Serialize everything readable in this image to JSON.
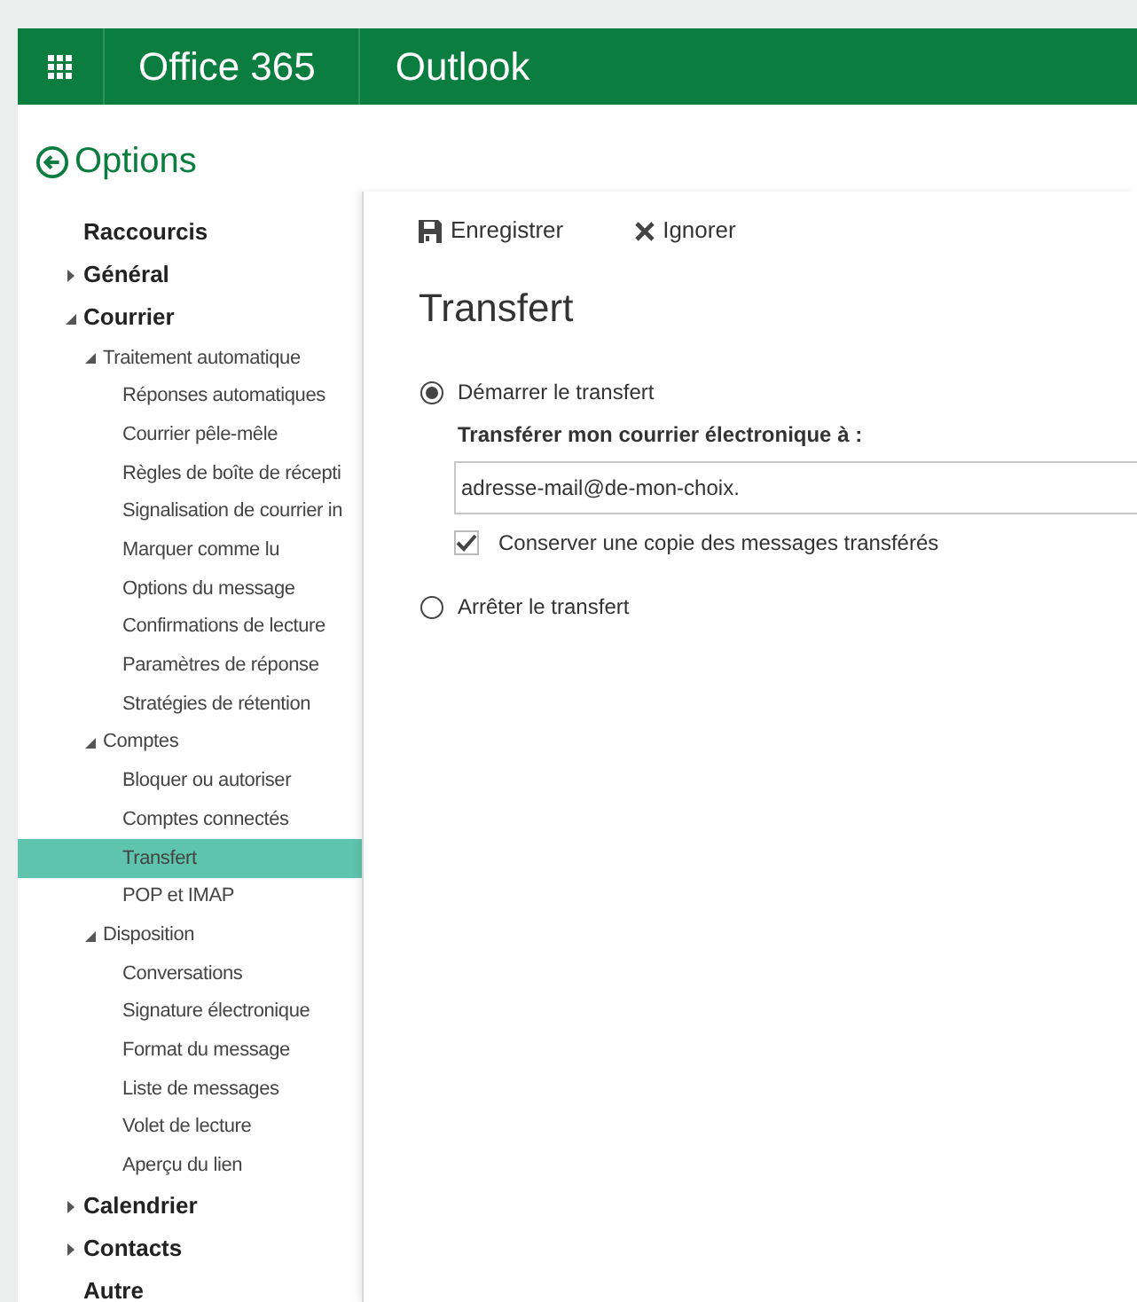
{
  "header": {
    "suite": "Office 365",
    "app": "Outlook"
  },
  "back_title": "Options",
  "sidebar": {
    "items": [
      {
        "label": "Raccourcis",
        "selected": false
      },
      {
        "label": "Général",
        "selected": false,
        "expanded": false
      },
      {
        "label": "Courrier",
        "selected": false,
        "expanded": true,
        "children": [
          {
            "label": "Traitement automatique",
            "selected": false,
            "expanded": true,
            "children": [
              {
                "label": "Réponses automatiques",
                "selected": false
              },
              {
                "label": "Courrier pêle-mêle",
                "selected": false
              },
              {
                "label": "Règles de boîte de récepti",
                "selected": false
              },
              {
                "label": "Signalisation de courrier in",
                "selected": false
              },
              {
                "label": "Marquer comme lu",
                "selected": false
              },
              {
                "label": "Options du message",
                "selected": false
              },
              {
                "label": "Confirmations de lecture",
                "selected": false
              },
              {
                "label": "Paramètres de réponse",
                "selected": false
              },
              {
                "label": "Stratégies de rétention",
                "selected": false
              }
            ]
          },
          {
            "label": "Comptes",
            "selected": false,
            "expanded": true,
            "children": [
              {
                "label": "Bloquer ou autoriser",
                "selected": false
              },
              {
                "label": "Comptes connectés",
                "selected": false
              },
              {
                "label": "Transfert",
                "selected": true
              },
              {
                "label": "POP et IMAP",
                "selected": false
              }
            ]
          },
          {
            "label": "Disposition",
            "selected": false,
            "expanded": true,
            "children": [
              {
                "label": "Conversations",
                "selected": false
              },
              {
                "label": "Signature électronique",
                "selected": false
              },
              {
                "label": "Format du message",
                "selected": false
              },
              {
                "label": "Liste de messages",
                "selected": false
              },
              {
                "label": "Volet de lecture",
                "selected": false
              },
              {
                "label": "Aperçu du lien",
                "selected": false
              }
            ]
          }
        ]
      },
      {
        "label": "Calendrier",
        "selected": false,
        "expanded": false
      },
      {
        "label": "Contacts",
        "selected": false,
        "expanded": false
      },
      {
        "label": "Autre",
        "selected": false
      }
    ]
  },
  "toolbar": [
    {
      "kind": "save",
      "label": "Enregistrer"
    },
    {
      "kind": "discard",
      "label": "Ignorer"
    }
  ],
  "title": "Transfert",
  "start_option": {
    "label": "Démarrer le transfert",
    "selected": true
  },
  "address_label": "Transférer mon courrier électronique à :",
  "address": "adresse-mail@de-mon-choix.",
  "keep_copy": {
    "label": "Conserver une copie des messages transférés",
    "checked": true
  },
  "stop_option": {
    "label": "Arrêter le transfert",
    "selected": false
  }
}
